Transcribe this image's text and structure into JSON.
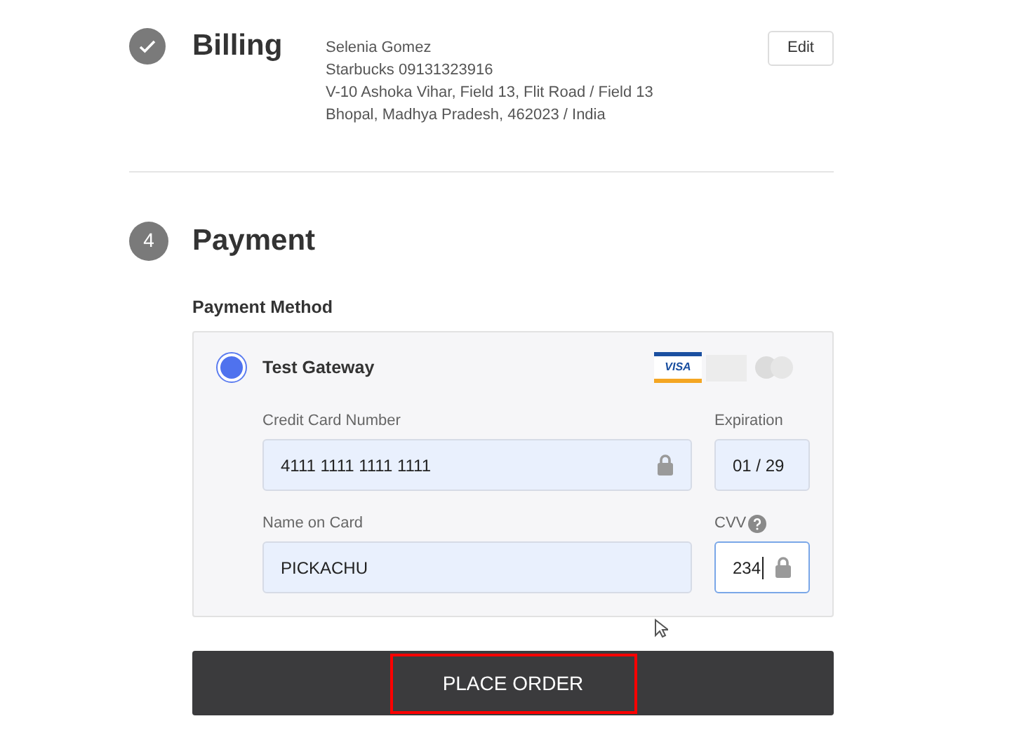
{
  "billing": {
    "title": "Billing",
    "completed": true,
    "address_lines": [
      "Selenia Gomez",
      "Starbucks 09131323916",
      "V-10 Ashoka Vihar, Field 13, Flit Road / Field 13",
      "Bhopal, Madhya Pradesh, 462023 / India"
    ],
    "edit_button": "Edit"
  },
  "payment": {
    "step": "4",
    "title": "Payment",
    "method_label": "Payment Method",
    "gateway": {
      "name": "Test Gateway",
      "selected": true,
      "card_logo_text": "VISA"
    },
    "fields": [
      {
        "label": "Credit Card Number",
        "value": "4111 1111 1111 1111",
        "locked": true,
        "focused": false,
        "help": false
      },
      {
        "label": "Expiration",
        "value": "01 / 29",
        "locked": false,
        "focused": false,
        "help": false
      },
      {
        "label": "Name on Card",
        "value": "PICKACHU",
        "locked": false,
        "focused": false,
        "help": false
      },
      {
        "label": "CVV",
        "value": "234",
        "locked": true,
        "focused": true,
        "help": true
      }
    ],
    "place_order": {
      "label": "PLACE ORDER",
      "highlighted": true
    }
  }
}
